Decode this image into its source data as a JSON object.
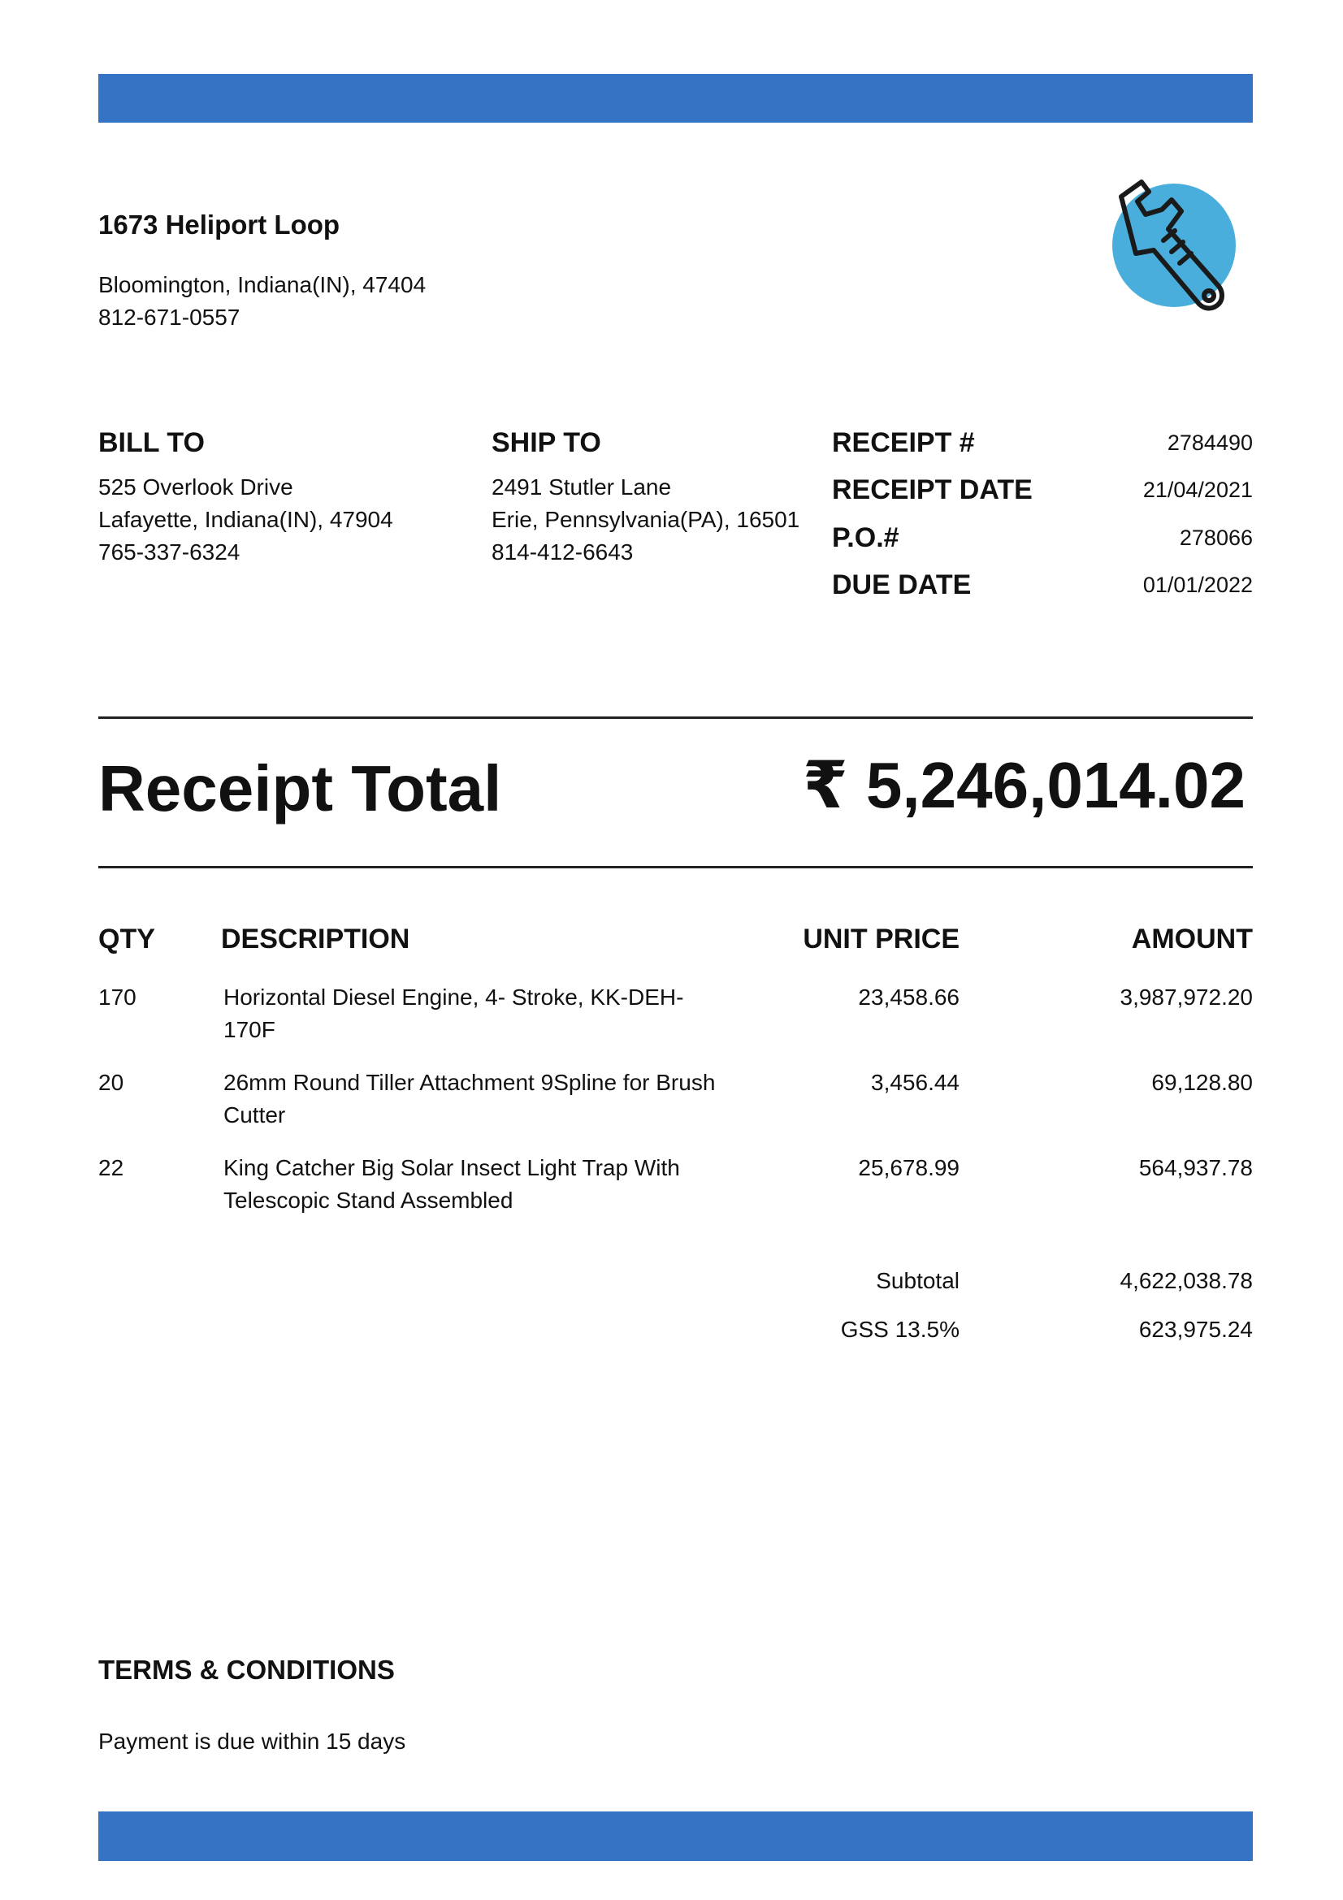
{
  "colors": {
    "band": "#3574c4",
    "logo_circle": "#4aaedc",
    "logo_icon": "wrench-icon"
  },
  "company": {
    "name": "1673 Heliport Loop",
    "address": "Bloomington, Indiana(IN), 47404",
    "phone": "812-671-0557"
  },
  "bill_to": {
    "title": "BILL TO",
    "street": "525 Overlook Drive",
    "city": "Lafayette, Indiana(IN), 47904",
    "phone": "765-337-6324"
  },
  "ship_to": {
    "title": "SHIP TO",
    "street": "2491 Stutler Lane",
    "city": "Erie, Pennsylvania(PA), 16501",
    "phone": "814-412-6643"
  },
  "meta": {
    "receipt_no_label": "RECEIPT #",
    "receipt_no": "2784490",
    "receipt_date_label": "RECEIPT DATE",
    "receipt_date": "21/04/2021",
    "po_label": "P.O.#",
    "po": "278066",
    "due_date_label": "DUE DATE",
    "due_date": "01/01/2022"
  },
  "total": {
    "label": "Receipt Total",
    "value": "₹ 5,246,014.02"
  },
  "table": {
    "headers": {
      "qty": "QTY",
      "description": "DESCRIPTION",
      "unit_price": "UNIT PRICE",
      "amount": "AMOUNT"
    },
    "rows": [
      {
        "qty": "170",
        "desc1": "Horizontal Diesel Engine, 4- Stroke, KK-DEH-",
        "desc2": "170F",
        "unit_price": "23,458.66",
        "amount": "3,987,972.20"
      },
      {
        "qty": "20",
        "desc1": "26mm Round Tiller Attachment 9Spline for Brush",
        "desc2": "Cutter",
        "unit_price": "3,456.44",
        "amount": "69,128.80"
      },
      {
        "qty": "22",
        "desc1": "King Catcher Big Solar Insect Light Trap With",
        "desc2": "Telescopic Stand Assembled",
        "unit_price": "25,678.99",
        "amount": "564,937.78"
      }
    ]
  },
  "summary": {
    "subtotal_label": "Subtotal",
    "subtotal": "4,622,038.78",
    "tax_label": "GSS 13.5%",
    "tax": "623,975.24"
  },
  "terms": {
    "title": "TERMS & CONDITIONS",
    "text": "Payment is due within 15 days"
  }
}
